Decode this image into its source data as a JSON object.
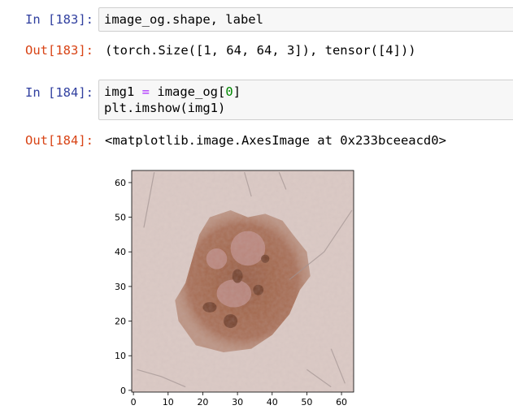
{
  "cells": [
    {
      "in_prompt": "In [183]:",
      "code": "image_og.shape, label",
      "out_prompt": "Out[183]:",
      "output": "(torch.Size([1, 64, 64, 3]), tensor([4]))"
    },
    {
      "in_prompt": "In [184]:",
      "code_line1": {
        "var": "img1",
        "op": "=",
        "rhs": "image_og[",
        "idx": "0",
        "close": "]"
      },
      "code_line2": "plt.imshow(img1)",
      "out_prompt": "Out[184]:",
      "output": "<matplotlib.image.AxesImage at 0x233bceeacd0>"
    }
  ],
  "chart_data": {
    "type": "heatmap",
    "title": "",
    "xlabel": "",
    "ylabel": "",
    "xlim": [
      -0.5,
      63.5
    ],
    "ylim": [
      63.5,
      -0.5
    ],
    "x_ticks": [
      0,
      10,
      20,
      30,
      40,
      50,
      60
    ],
    "y_ticks": [
      0,
      10,
      20,
      30,
      40,
      50,
      60
    ],
    "image_size": [
      64,
      64
    ],
    "grid": false,
    "legend": "none",
    "colors": {
      "skin": "#dccbc6",
      "lesion": "#a3674c",
      "lesion_dark": "#6e3e2a",
      "lesion_pink": "#c49492"
    }
  }
}
